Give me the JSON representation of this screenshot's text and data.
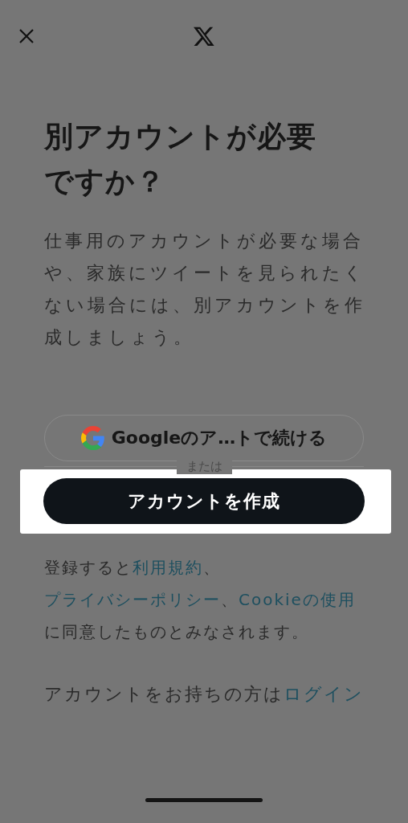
{
  "title": "別アカウントが必要ですか？",
  "description": "仕事用のアカウントが必要な場合や、家族にツイートを見られたくない場合には、別アカウントを作成しましょう。",
  "google_button": {
    "label": "Googleのア…トで続ける"
  },
  "divider": "または",
  "create_button": {
    "label": "アカウントを作成",
    "highlighted": true
  },
  "terms": [
    {
      "text": "登録すると",
      "kind": "plain"
    },
    {
      "text": "利用規約",
      "kind": "link"
    },
    {
      "text": "、",
      "kind": "plain"
    },
    {
      "text": "プライバシーポリシー",
      "kind": "link"
    },
    {
      "text": "、",
      "kind": "plain"
    },
    {
      "text": "Cookieの使用",
      "kind": "link"
    },
    {
      "text": "に同意したものとみなされます。",
      "kind": "plain"
    }
  ],
  "login": [
    {
      "text": "アカウントをお持ちの方は",
      "kind": "plain"
    },
    {
      "text": "ログイン",
      "kind": "link"
    }
  ]
}
